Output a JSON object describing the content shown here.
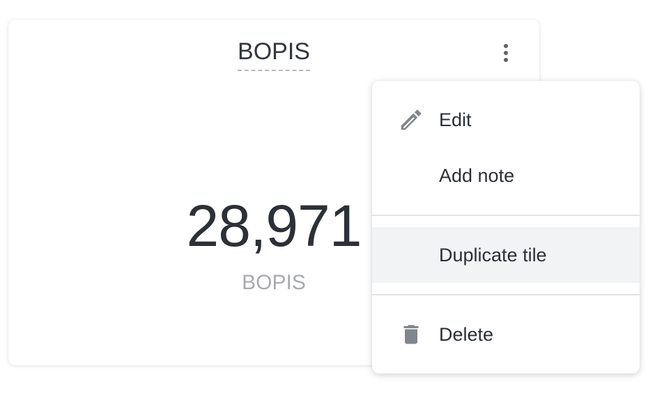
{
  "tile": {
    "title": "BOPIS",
    "value": "28,971",
    "subtitle": "BOPIS",
    "menu_icon": "kebab-more-vertical-icon"
  },
  "menu": {
    "items": [
      {
        "label": "Edit",
        "icon": "pencil-icon"
      },
      {
        "label": "Add note",
        "icon": ""
      },
      {
        "label": "Duplicate tile",
        "icon": "",
        "highlighted": true
      },
      {
        "label": "Delete",
        "icon": "trash-icon"
      }
    ]
  },
  "colors": {
    "text_primary": "#2b2f35",
    "text_muted": "#a8aaad",
    "icon_gray": "#80868b",
    "hover_bg": "#f1f3f4"
  }
}
